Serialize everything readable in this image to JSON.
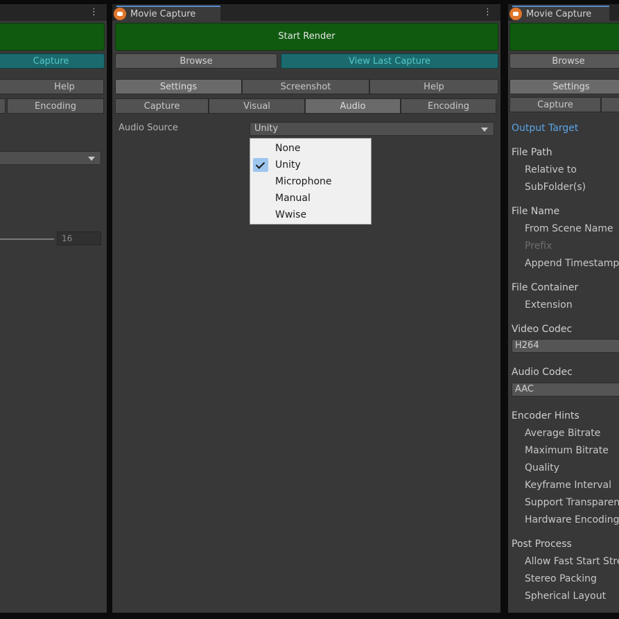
{
  "left_panel": {
    "capture_button": "Capture",
    "help_tab": "Help",
    "encoding_tab": "Encoding",
    "slider_value": "16"
  },
  "mid_panel": {
    "tab_title": "Movie Capture",
    "start_render": "Start Render",
    "browse": "Browse",
    "view_last_capture": "View Last Capture",
    "top_tabs": [
      "Settings",
      "Screenshot",
      "Help"
    ],
    "sub_tabs": [
      "Capture",
      "Visual",
      "Audio",
      "Encoding"
    ],
    "active_sub_tab": "Audio",
    "audio_source_label": "Audio Source",
    "audio_source_value": "Unity",
    "menu_options": [
      "None",
      "Unity",
      "Microphone",
      "Manual",
      "Wwise"
    ],
    "menu_selected": "Unity"
  },
  "right_panel": {
    "tab_title": "Movie Capture",
    "browse": "Browse",
    "settings": "Settings",
    "capture": "Capture",
    "output_target": "Output Target",
    "file_path": "File Path",
    "relative_to": "Relative to",
    "subfolders": "SubFolder(s)",
    "file_name": "File Name",
    "from_scene_name": "From Scene Name",
    "prefix": "Prefix",
    "append_timestamp": "Append Timestamp",
    "file_container": "File Container",
    "extension": "Extension",
    "video_codec": "Video Codec",
    "video_codec_value": "H264",
    "audio_codec": "Audio Codec",
    "audio_codec_value": "AAC",
    "encoder_hints": "Encoder Hints",
    "average_bitrate": "Average Bitrate",
    "maximum_bitrate": "Maximum Bitrate",
    "quality": "Quality",
    "keyframe_interval": "Keyframe Interval",
    "support_transparency": "Support Transparency",
    "hardware_encoding": "Hardware Encoding",
    "post_process": "Post Process",
    "allow_fast_start": "Allow Fast Start Streaming",
    "stereo_packing": "Stereo Packing",
    "spherical_layout": "Spherical Layout"
  },
  "colors": {
    "green_button": "#0f5a0f",
    "teal_button": "#1a6a6e",
    "link_blue": "#5aa6e8",
    "tab_accent": "#e0762a"
  }
}
